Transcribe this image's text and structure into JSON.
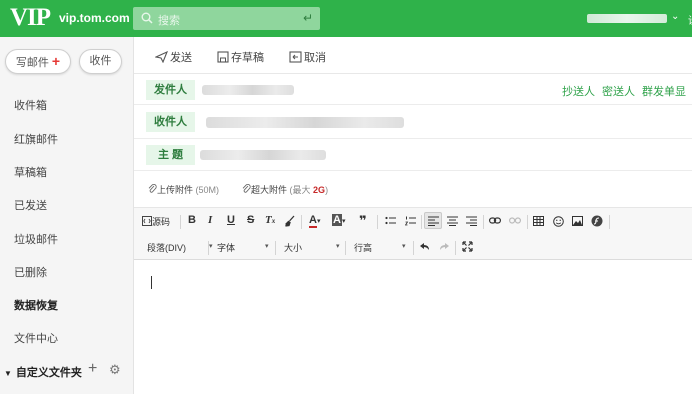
{
  "header": {
    "logo": "VIP",
    "domain": "vip.tom.com",
    "search_placeholder": "搜索",
    "search_enter": "↵",
    "user_caret": "⌄",
    "edge_char": "设"
  },
  "sidebar": {
    "compose_label": "写邮件",
    "compose_plus": "+",
    "receive_label": "收件",
    "folders": [
      "收件箱",
      "红旗邮件",
      "草稿箱",
      "已发送",
      "垃圾邮件",
      "已删除",
      "数据恢复",
      "文件中心"
    ],
    "custom_folders": "自定义文件夹",
    "custom_triangle": "▼",
    "add_symbol": "+",
    "gear_symbol": "⚙"
  },
  "actions": {
    "send": "发送",
    "save_draft": "存草稿",
    "cancel": "取消"
  },
  "compose": {
    "from_label": "发件人",
    "to_label": "收件人",
    "subject_label": "主 题",
    "cc": "抄送人",
    "bcc": "密送人",
    "separate_send": "群发单显",
    "upload_attachment": "上传附件",
    "upload_limit": "(50M)",
    "large_attachment": "超大附件",
    "large_limit_prefix": "(最大",
    "large_limit_value": "2G",
    "large_limit_suffix": ")"
  },
  "editor_toolbar": {
    "source": "源码",
    "bold": "B",
    "italic": "I",
    "underline": "U",
    "strike": "S",
    "clear_format": "T",
    "font_color": "A",
    "bg_color": "A",
    "quote": "❞",
    "paragraph": "段落(DIV)",
    "font": "字体",
    "size": "大小",
    "line_height": "行高",
    "dropdown_caret": "▾"
  },
  "colors": {
    "brand_green": "#2fb24a",
    "label_bg": "#e6f6e9",
    "link_green": "#2fa24a",
    "limit_red": "#c62828"
  }
}
